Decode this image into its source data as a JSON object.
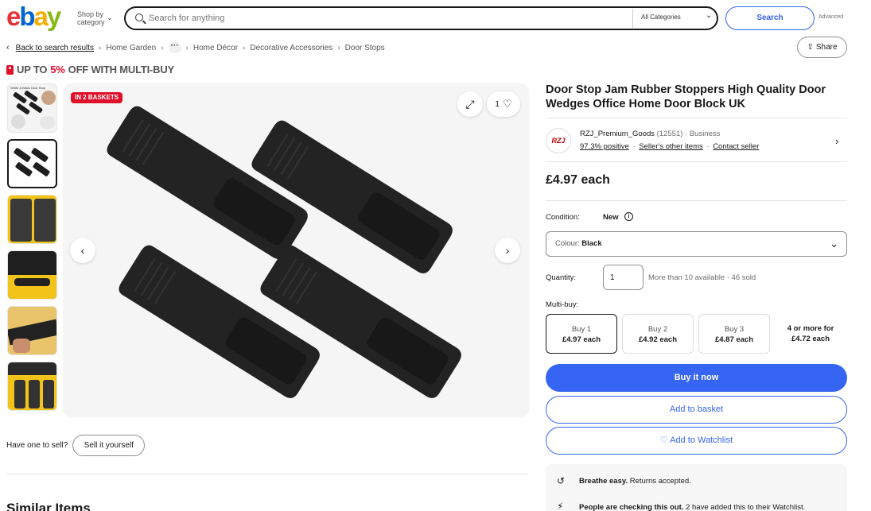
{
  "header": {
    "logo": {
      "e": "e",
      "b": "b",
      "a": "a",
      "y": "y"
    },
    "shop_by_line1": "Shop by",
    "shop_by_line2": "category",
    "search_placeholder": "Search for anything",
    "category_select": "All Categories",
    "search_button": "Search",
    "advanced_link": "Advanced"
  },
  "breadcrumb": {
    "back": "Back to search results",
    "items": [
      "Home Garden",
      "Home Décor",
      "Decorative Accessories",
      "Door Stops"
    ],
    "ellipsis": "···"
  },
  "share_label": "Share",
  "promo": {
    "prefix": "UP TO",
    "percent": "5%",
    "suffix": "OFF WITH MULTI-BUY"
  },
  "gallery": {
    "badge": "IN 2 BASKETS",
    "watch_count": "1",
    "thumb_text": "White & Black Door Stop"
  },
  "sell": {
    "prompt": "Have one to sell?",
    "button": "Sell it yourself"
  },
  "similar_heading": "Similar Items",
  "listing": {
    "title": "Door Stop Jam Rubber Stoppers High Quality Door Wedges Office Home Door Block UK",
    "seller_name": "RZJ_Premium_Goods",
    "seller_feedback": "(12551)",
    "seller_type": "· Business",
    "seller_logo": "RZJ",
    "seller_positive": "97.3% positive",
    "seller_other": "Seller's other items",
    "seller_contact": "Contact seller",
    "price": "£4.97 each",
    "condition_label": "Condition:",
    "condition_value": "New",
    "colour_label": "Colour:",
    "colour_value": "Black",
    "quantity_label": "Quantity:",
    "quantity_value": "1",
    "quantity_avail": "More than 10 available · 46 sold",
    "multibuy_label": "Multi-buy:",
    "multibuy": [
      {
        "qty": "Buy 1",
        "price": "£4.97 each"
      },
      {
        "qty": "Buy 2",
        "price": "£4.92 each"
      },
      {
        "qty": "Buy 3",
        "price": "£4.87 each"
      },
      {
        "qty": "4 or more for",
        "price": "£4.72 each"
      }
    ],
    "buy_now": "Buy it now",
    "add_basket": "Add to basket",
    "add_watchlist": "♡ Add to Watchlist",
    "breathe_bold": "Breathe easy.",
    "breathe_rest": " Returns accepted.",
    "checking_bold": "People are checking this out.",
    "checking_rest": " 2 have added this to their Watchlist."
  },
  "colors": {
    "brand_blue": "#3665f3",
    "promo_red": "#e0102b"
  }
}
